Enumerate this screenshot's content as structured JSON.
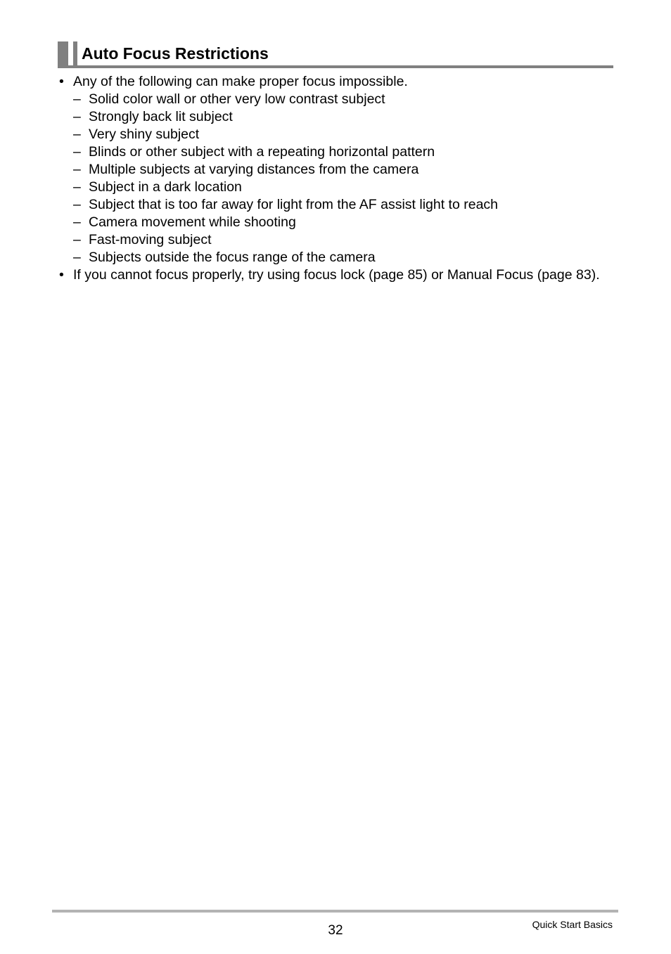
{
  "section": {
    "title": "Auto Focus Restrictions"
  },
  "bullets": [
    {
      "mark": "•",
      "text": "Any of the following can make proper focus impossible.",
      "subitems": [
        {
          "mark": "–",
          "text": "Solid color wall or other very low contrast subject"
        },
        {
          "mark": "–",
          "text": "Strongly back lit subject"
        },
        {
          "mark": "–",
          "text": "Very shiny subject"
        },
        {
          "mark": "–",
          "text": "Blinds or other subject with a repeating horizontal pattern"
        },
        {
          "mark": "–",
          "text": "Multiple subjects at varying distances from the camera"
        },
        {
          "mark": "–",
          "text": "Subject in a dark location"
        },
        {
          "mark": "–",
          "text": "Subject that is too far away for light from the AF assist light to reach"
        },
        {
          "mark": "–",
          "text": "Camera movement while shooting"
        },
        {
          "mark": "–",
          "text": "Fast-moving subject"
        },
        {
          "mark": "–",
          "text": "Subjects outside the focus range of the camera"
        }
      ]
    },
    {
      "mark": "•",
      "text": "If you cannot focus properly, try using focus lock (page 85) or Manual Focus (page 83)."
    }
  ],
  "footer": {
    "page_number": "32",
    "section_name": "Quick Start Basics"
  }
}
